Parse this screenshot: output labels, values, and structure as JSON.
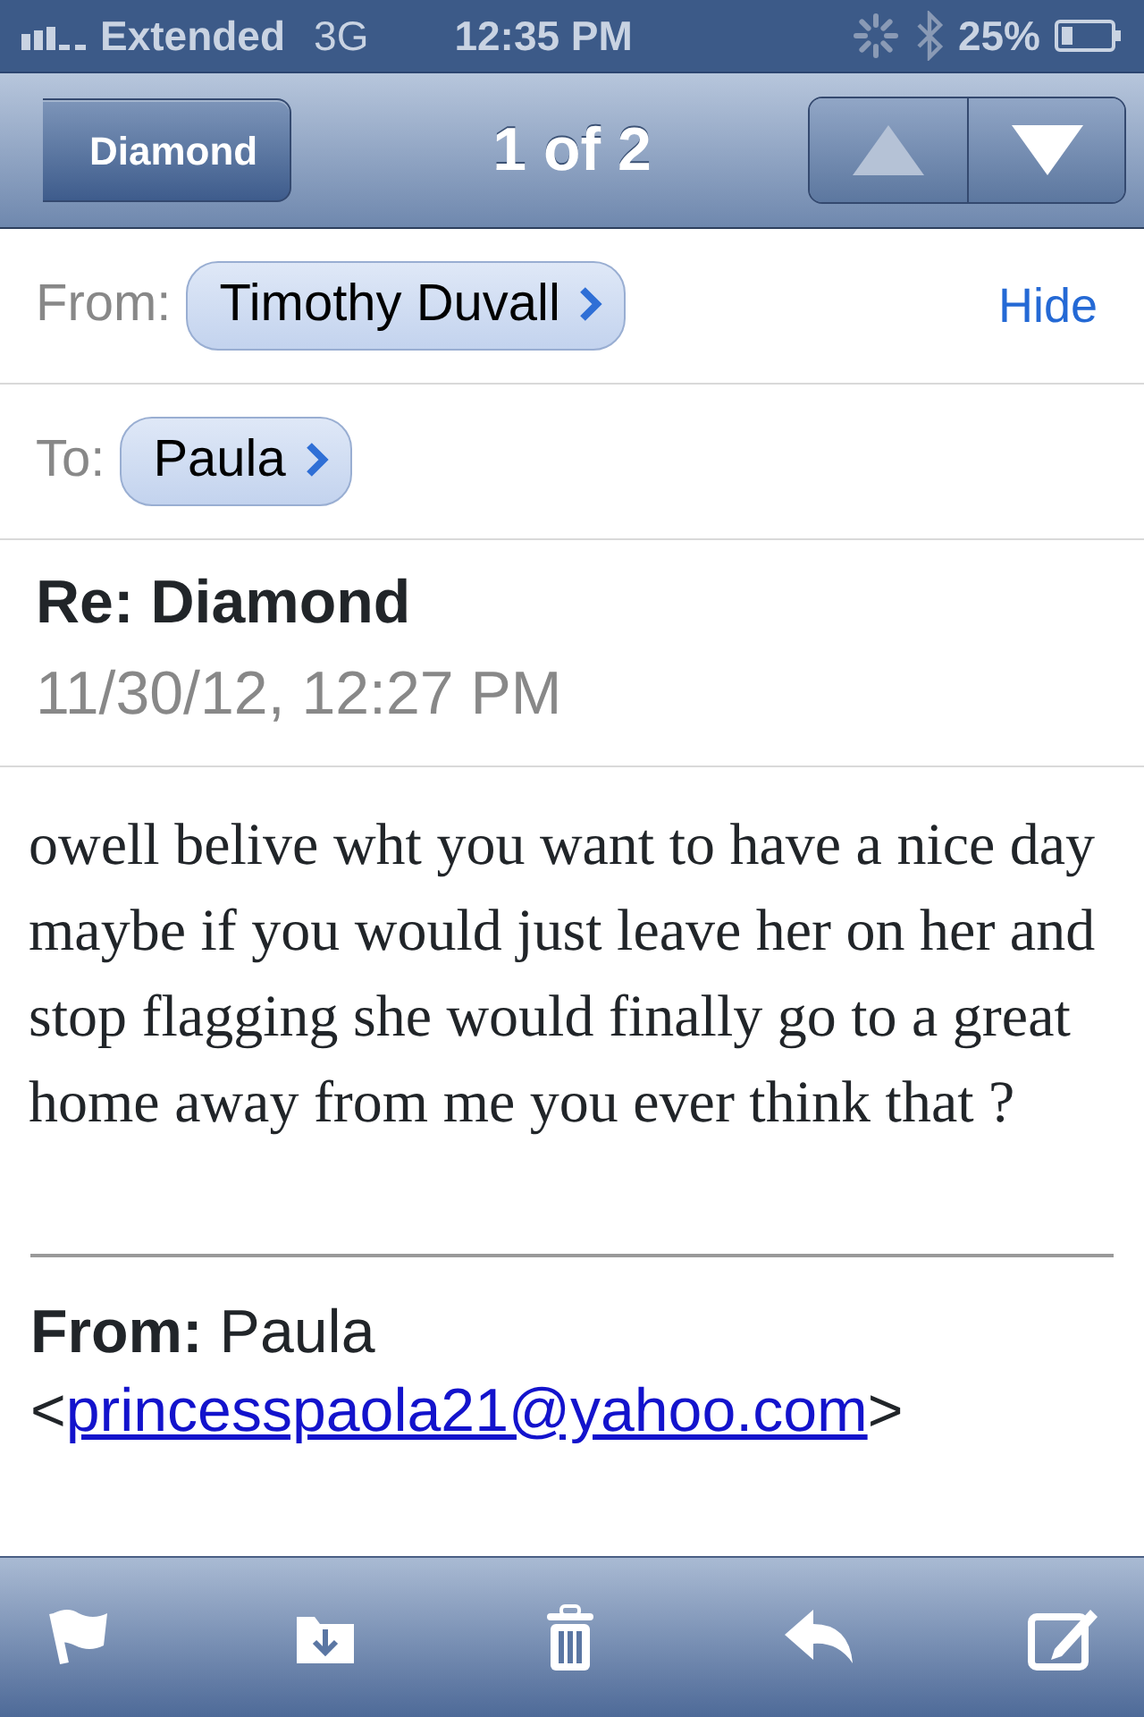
{
  "status_bar": {
    "carrier": "Extended",
    "network": "3G",
    "time": "12:35 PM",
    "battery": "25%"
  },
  "nav_bar": {
    "back": "Diamond",
    "title": "1 of 2",
    "buttons": [
      {
        "kind": "up",
        "disabled": true
      },
      {
        "kind": "down",
        "disabled": false
      }
    ]
  },
  "header": {
    "from_label": "From:",
    "from": "Timothy Duvall",
    "hide": "Hide",
    "to_label": "To:",
    "to": "Paula",
    "subject": "Re: Diamond",
    "date": "11/30/12, 12:27 PM"
  },
  "body": "owell belive wht you want to have a nice day maybe if you would just leave her on her and stop flagging she would finally go to a great home away from me you ever think that ?",
  "quoted": {
    "from_label": "From:",
    "from_name": "Paula",
    "open": "<",
    "email": "princesspaola21@yahoo.com",
    "close": ">"
  },
  "toolbar": [
    {
      "kind": "flag"
    },
    {
      "kind": "move"
    },
    {
      "kind": "trash"
    },
    {
      "kind": "reply"
    },
    {
      "kind": "compose"
    }
  ]
}
